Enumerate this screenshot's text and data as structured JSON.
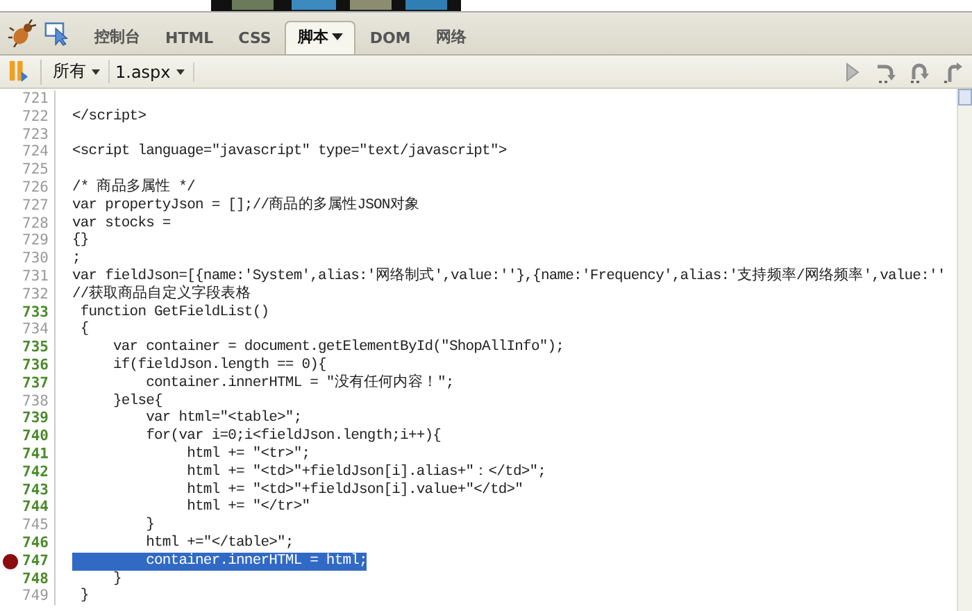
{
  "tabs": [
    {
      "label": "控制台",
      "selected": false,
      "menu": false
    },
    {
      "label": "HTML",
      "selected": false,
      "menu": false
    },
    {
      "label": "CSS",
      "selected": false,
      "menu": false
    },
    {
      "label": "脚本",
      "selected": true,
      "menu": true
    },
    {
      "label": "DOM",
      "selected": false,
      "menu": false
    },
    {
      "label": "网络",
      "selected": false,
      "menu": false
    }
  ],
  "script_toolbar": {
    "filters": [
      {
        "label": "所有"
      },
      {
        "label": "1.aspx"
      }
    ]
  },
  "lines": [
    {
      "number": "721",
      "executable": false,
      "breakpoint": false,
      "current": false
    },
    {
      "number": "722",
      "text": "</script>",
      "executable": false,
      "breakpoint": false,
      "current": false
    },
    {
      "number": "723",
      "executable": false,
      "breakpoint": false,
      "current": false
    },
    {
      "number": "724",
      "text": "<script language=\"javascript\" type=\"text/javascript\">",
      "executable": false,
      "breakpoint": false,
      "current": false
    },
    {
      "number": "725",
      "executable": false,
      "breakpoint": false,
      "current": false
    },
    {
      "number": "726",
      "text": "/* 商品多属性 */",
      "executable": false,
      "breakpoint": false,
      "current": false
    },
    {
      "number": "727",
      "text": "var propertyJson = [];//商品的多属性JSON对象",
      "executable": false,
      "breakpoint": false,
      "current": false
    },
    {
      "number": "728",
      "text": "var stocks =",
      "executable": false,
      "breakpoint": false,
      "current": false
    },
    {
      "number": "729",
      "text": "{}",
      "executable": false,
      "breakpoint": false,
      "current": false
    },
    {
      "number": "730",
      "text": ";",
      "executable": false,
      "breakpoint": false,
      "current": false
    },
    {
      "number": "731",
      "text": "var fieldJson=[{name:'System',alias:'网络制式',value:''},{name:'Frequency',alias:'支持频率/网络频率',value:''",
      "executable": false,
      "breakpoint": false,
      "current": false
    },
    {
      "number": "732",
      "text": "//获取商品自定义字段表格",
      "executable": false,
      "breakpoint": false,
      "current": false
    },
    {
      "number": "733",
      "text": " function GetFieldList()",
      "executable": true,
      "breakpoint": false,
      "current": false
    },
    {
      "number": "734",
      "text": " {",
      "executable": false,
      "breakpoint": false,
      "current": false
    },
    {
      "number": "735",
      "text": "     var container = document.getElementById(\"ShopAllInfo\");",
      "executable": true,
      "breakpoint": false,
      "current": false
    },
    {
      "number": "736",
      "text": "     if(fieldJson.length == 0){",
      "executable": true,
      "breakpoint": false,
      "current": false
    },
    {
      "number": "737",
      "text": "         container.innerHTML = \"没有任何内容！\";",
      "executable": true,
      "breakpoint": false,
      "current": false
    },
    {
      "number": "738",
      "text": "     }else{",
      "executable": false,
      "breakpoint": false,
      "current": false
    },
    {
      "number": "739",
      "text": "         var html=\"<table>\";",
      "executable": true,
      "breakpoint": false,
      "current": false
    },
    {
      "number": "740",
      "text": "         for(var i=0;i<fieldJson.length;i++){",
      "executable": true,
      "breakpoint": false,
      "current": false
    },
    {
      "number": "741",
      "text": "              html += \"<tr>\";",
      "executable": true,
      "breakpoint": false,
      "current": false
    },
    {
      "number": "742",
      "text": "              html += \"<td>\"+fieldJson[i].alias+\"：</td>\";",
      "executable": true,
      "breakpoint": false,
      "current": false
    },
    {
      "number": "743",
      "text": "              html += \"<td>\"+fieldJson[i].value+\"</td>\"",
      "executable": true,
      "breakpoint": false,
      "current": false
    },
    {
      "number": "744",
      "text": "              html += \"</tr>\"",
      "executable": true,
      "breakpoint": false,
      "current": false
    },
    {
      "number": "745",
      "text": "         }",
      "executable": false,
      "breakpoint": false,
      "current": false
    },
    {
      "number": "746",
      "text": "         html +=\"</table>\";",
      "executable": true,
      "breakpoint": false,
      "current": false
    },
    {
      "number": "747",
      "text": "         container.innerHTML = html;",
      "executable": true,
      "breakpoint": true,
      "current": true
    },
    {
      "number": "748",
      "text": "     }",
      "executable": true,
      "breakpoint": false,
      "current": false
    },
    {
      "number": "749",
      "text": " }",
      "executable": false,
      "breakpoint": false,
      "current": false
    }
  ]
}
